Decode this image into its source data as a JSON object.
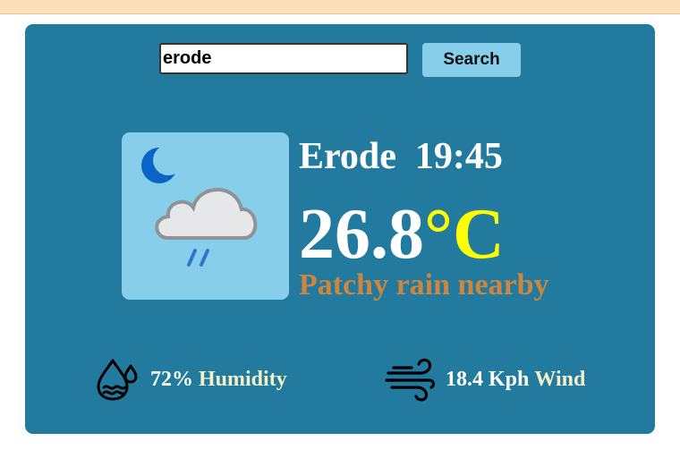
{
  "search": {
    "value": "erode",
    "button_label": "Search"
  },
  "weather": {
    "city": "Erode",
    "time": "19:45",
    "temperature": "26.8",
    "unit": "°C",
    "condition": "Patchy rain nearby",
    "icon": "night-cloud-rain-icon"
  },
  "stats": {
    "humidity_value": "72%",
    "humidity_label": "Humidity",
    "wind_value": "18.4 Kph",
    "wind_label": "Wind"
  },
  "colors": {
    "top_bar": "#ffdfb8",
    "card": "#227b9e",
    "icon_box": "#87ceeb",
    "search_button": "#87ceeb",
    "temperature_unit": "#ffff00",
    "condition_text": "#cd853f",
    "stat_label": "#f5f0c8"
  }
}
